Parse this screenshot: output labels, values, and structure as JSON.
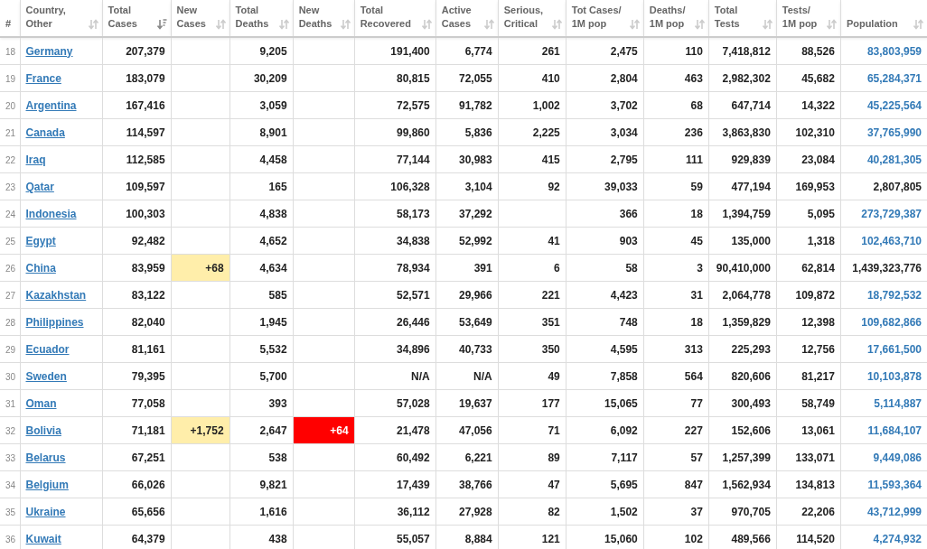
{
  "table": {
    "columns": [
      {
        "label": [
          "#"
        ],
        "sortable": false
      },
      {
        "label": [
          "Country,",
          "Other"
        ],
        "sortable": true,
        "sorted": false
      },
      {
        "label": [
          "Total",
          "Cases"
        ],
        "sortable": true,
        "sorted": true
      },
      {
        "label": [
          "New",
          "Cases"
        ],
        "sortable": true,
        "sorted": false
      },
      {
        "label": [
          "Total",
          "Deaths"
        ],
        "sortable": true,
        "sorted": false
      },
      {
        "label": [
          "New",
          "Deaths"
        ],
        "sortable": true,
        "sorted": false
      },
      {
        "label": [
          "Total",
          "Recovered"
        ],
        "sortable": true,
        "sorted": false
      },
      {
        "label": [
          "Active",
          "Cases"
        ],
        "sortable": true,
        "sorted": false
      },
      {
        "label": [
          "Serious,",
          "Critical"
        ],
        "sortable": true,
        "sorted": false
      },
      {
        "label": [
          "Tot Cases/",
          "1M pop"
        ],
        "sortable": true,
        "sorted": false
      },
      {
        "label": [
          "Deaths/",
          "1M pop"
        ],
        "sortable": true,
        "sorted": false
      },
      {
        "label": [
          "Total",
          "Tests"
        ],
        "sortable": true,
        "sorted": false
      },
      {
        "label": [
          "Tests/",
          "1M pop"
        ],
        "sortable": true,
        "sorted": false
      },
      {
        "label": [
          "Population"
        ],
        "sortable": true,
        "sorted": false
      }
    ],
    "rows": [
      {
        "rank": "18",
        "country": "Germany",
        "total_cases": "207,379",
        "total_deaths": "9,205",
        "total_recovered": "191,400",
        "active_cases": "6,774",
        "serious_critical": "261",
        "cases_per_1m": "2,475",
        "deaths_per_1m": "110",
        "total_tests": "7,418,812",
        "tests_per_1m": "88,526",
        "population": "83,803,959",
        "population_linked": true
      },
      {
        "rank": "19",
        "country": "France",
        "total_cases": "183,079",
        "total_deaths": "30,209",
        "total_recovered": "80,815",
        "active_cases": "72,055",
        "serious_critical": "410",
        "cases_per_1m": "2,804",
        "deaths_per_1m": "463",
        "total_tests": "2,982,302",
        "tests_per_1m": "45,682",
        "population": "65,284,371",
        "population_linked": true
      },
      {
        "rank": "20",
        "country": "Argentina",
        "total_cases": "167,416",
        "total_deaths": "3,059",
        "total_recovered": "72,575",
        "active_cases": "91,782",
        "serious_critical": "1,002",
        "cases_per_1m": "3,702",
        "deaths_per_1m": "68",
        "total_tests": "647,714",
        "tests_per_1m": "14,322",
        "population": "45,225,564",
        "population_linked": true
      },
      {
        "rank": "21",
        "country": "Canada",
        "total_cases": "114,597",
        "total_deaths": "8,901",
        "total_recovered": "99,860",
        "active_cases": "5,836",
        "serious_critical": "2,225",
        "cases_per_1m": "3,034",
        "deaths_per_1m": "236",
        "total_tests": "3,863,830",
        "tests_per_1m": "102,310",
        "population": "37,765,990",
        "population_linked": true
      },
      {
        "rank": "22",
        "country": "Iraq",
        "total_cases": "112,585",
        "total_deaths": "4,458",
        "total_recovered": "77,144",
        "active_cases": "30,983",
        "serious_critical": "415",
        "cases_per_1m": "2,795",
        "deaths_per_1m": "111",
        "total_tests": "929,839",
        "tests_per_1m": "23,084",
        "population": "40,281,305",
        "population_linked": true
      },
      {
        "rank": "23",
        "country": "Qatar",
        "total_cases": "109,597",
        "total_deaths": "165",
        "total_recovered": "106,328",
        "active_cases": "3,104",
        "serious_critical": "92",
        "cases_per_1m": "39,033",
        "deaths_per_1m": "59",
        "total_tests": "477,194",
        "tests_per_1m": "169,953",
        "population": "2,807,805",
        "population_linked": false
      },
      {
        "rank": "24",
        "country": "Indonesia",
        "total_cases": "100,303",
        "total_deaths": "4,838",
        "total_recovered": "58,173",
        "active_cases": "37,292",
        "cases_per_1m": "366",
        "deaths_per_1m": "18",
        "total_tests": "1,394,759",
        "tests_per_1m": "5,095",
        "population": "273,729,387",
        "population_linked": true
      },
      {
        "rank": "25",
        "country": "Egypt",
        "total_cases": "92,482",
        "total_deaths": "4,652",
        "total_recovered": "34,838",
        "active_cases": "52,992",
        "serious_critical": "41",
        "cases_per_1m": "903",
        "deaths_per_1m": "45",
        "total_tests": "135,000",
        "tests_per_1m": "1,318",
        "population": "102,463,710",
        "population_linked": true
      },
      {
        "rank": "26",
        "country": "China",
        "total_cases": "83,959",
        "new_cases": "+68",
        "total_deaths": "4,634",
        "total_recovered": "78,934",
        "active_cases": "391",
        "serious_critical": "6",
        "cases_per_1m": "58",
        "deaths_per_1m": "3",
        "total_tests": "90,410,000",
        "tests_per_1m": "62,814",
        "population": "1,439,323,776",
        "population_linked": false
      },
      {
        "rank": "27",
        "country": "Kazakhstan",
        "total_cases": "83,122",
        "total_deaths": "585",
        "total_recovered": "52,571",
        "active_cases": "29,966",
        "serious_critical": "221",
        "cases_per_1m": "4,423",
        "deaths_per_1m": "31",
        "total_tests": "2,064,778",
        "tests_per_1m": "109,872",
        "population": "18,792,532",
        "population_linked": true
      },
      {
        "rank": "28",
        "country": "Philippines",
        "total_cases": "82,040",
        "total_deaths": "1,945",
        "total_recovered": "26,446",
        "active_cases": "53,649",
        "serious_critical": "351",
        "cases_per_1m": "748",
        "deaths_per_1m": "18",
        "total_tests": "1,359,829",
        "tests_per_1m": "12,398",
        "population": "109,682,866",
        "population_linked": true
      },
      {
        "rank": "29",
        "country": "Ecuador",
        "total_cases": "81,161",
        "total_deaths": "5,532",
        "total_recovered": "34,896",
        "active_cases": "40,733",
        "serious_critical": "350",
        "cases_per_1m": "4,595",
        "deaths_per_1m": "313",
        "total_tests": "225,293",
        "tests_per_1m": "12,756",
        "population": "17,661,500",
        "population_linked": true
      },
      {
        "rank": "30",
        "country": "Sweden",
        "total_cases": "79,395",
        "total_deaths": "5,700",
        "total_recovered": "N/A",
        "active_cases": "N/A",
        "serious_critical": "49",
        "cases_per_1m": "7,858",
        "deaths_per_1m": "564",
        "total_tests": "820,606",
        "tests_per_1m": "81,217",
        "population": "10,103,878",
        "population_linked": true
      },
      {
        "rank": "31",
        "country": "Oman",
        "total_cases": "77,058",
        "total_deaths": "393",
        "total_recovered": "57,028",
        "active_cases": "19,637",
        "serious_critical": "177",
        "cases_per_1m": "15,065",
        "deaths_per_1m": "77",
        "total_tests": "300,493",
        "tests_per_1m": "58,749",
        "population": "5,114,887",
        "population_linked": true
      },
      {
        "rank": "32",
        "country": "Bolivia",
        "total_cases": "71,181",
        "new_cases": "+1,752",
        "total_deaths": "2,647",
        "new_deaths": "+64",
        "total_recovered": "21,478",
        "active_cases": "47,056",
        "serious_critical": "71",
        "cases_per_1m": "6,092",
        "deaths_per_1m": "227",
        "total_tests": "152,606",
        "tests_per_1m": "13,061",
        "population": "11,684,107",
        "population_linked": true
      },
      {
        "rank": "33",
        "country": "Belarus",
        "total_cases": "67,251",
        "total_deaths": "538",
        "total_recovered": "60,492",
        "active_cases": "6,221",
        "serious_critical": "89",
        "cases_per_1m": "7,117",
        "deaths_per_1m": "57",
        "total_tests": "1,257,399",
        "tests_per_1m": "133,071",
        "population": "9,449,086",
        "population_linked": true
      },
      {
        "rank": "34",
        "country": "Belgium",
        "total_cases": "66,026",
        "total_deaths": "9,821",
        "total_recovered": "17,439",
        "active_cases": "38,766",
        "serious_critical": "47",
        "cases_per_1m": "5,695",
        "deaths_per_1m": "847",
        "total_tests": "1,562,934",
        "tests_per_1m": "134,813",
        "population": "11,593,364",
        "population_linked": true
      },
      {
        "rank": "35",
        "country": "Ukraine",
        "total_cases": "65,656",
        "total_deaths": "1,616",
        "total_recovered": "36,112",
        "active_cases": "27,928",
        "serious_critical": "82",
        "cases_per_1m": "1,502",
        "deaths_per_1m": "37",
        "total_tests": "970,705",
        "tests_per_1m": "22,206",
        "population": "43,712,999",
        "population_linked": true
      },
      {
        "rank": "36",
        "country": "Kuwait",
        "total_cases": "64,379",
        "total_deaths": "438",
        "total_recovered": "55,057",
        "active_cases": "8,884",
        "serious_critical": "121",
        "cases_per_1m": "15,060",
        "deaths_per_1m": "102",
        "total_tests": "489,566",
        "tests_per_1m": "114,520",
        "population": "4,274,932",
        "population_linked": true
      }
    ]
  }
}
